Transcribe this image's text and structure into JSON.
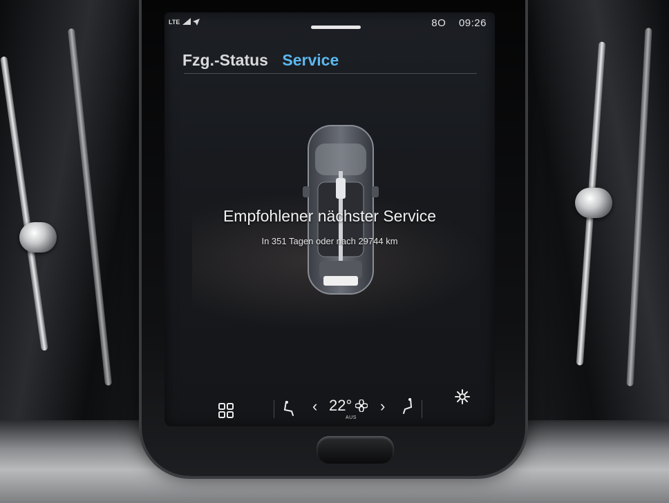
{
  "status_bar": {
    "network_label": "LTE",
    "signal_icon": "signal-icon",
    "navigation_icon": "navigation-arrow-icon",
    "temperature": "8O",
    "time": "09:26"
  },
  "tabs": [
    {
      "label": "Fzg.-Status",
      "active": false
    },
    {
      "label": "Service",
      "active": true
    }
  ],
  "service": {
    "title": "Empfohlener nächster Service",
    "detail": "In 351 Tagen oder nach 29744 km"
  },
  "climate_bar": {
    "app_grid_icon": "app-grid-icon",
    "seat_left_icon": "seat-heating-left-icon",
    "temperature": "22°",
    "fan_icon": "fan-icon",
    "fan_status": "AUS",
    "seat_right_icon": "seat-heating-right-icon",
    "settings_icon": "gear-icon"
  },
  "colors": {
    "accent": "#5cb8f0",
    "screen_bg": "#1a1c20",
    "text": "#eaeaea"
  }
}
